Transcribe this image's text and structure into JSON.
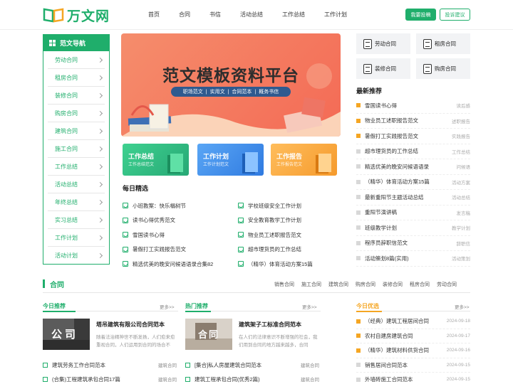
{
  "header": {
    "logo_text": "万文网",
    "nav": [
      "首页",
      "合同",
      "书信",
      "活动总结",
      "工作总结",
      "工作计划"
    ],
    "submit_label": "我要投稿",
    "advice_label": "投诉建议"
  },
  "sidebar": {
    "title": "范文导航",
    "items": [
      "劳动合同",
      "租房合同",
      "装修合同",
      "购房合同",
      "建筑合同",
      "施工合同",
      "工作总结",
      "活动总结",
      "年终总结",
      "实习总结",
      "工作计划",
      "活动计划"
    ]
  },
  "banner": {
    "title": "范文模板资料平台",
    "tags": [
      "职场范文",
      "实用文",
      "合同范本",
      "概务书信"
    ]
  },
  "cards": [
    {
      "title": "工作总结",
      "sub": "工作总结范文",
      "color": "#3cc28a"
    },
    {
      "title": "工作计划",
      "sub": "工作计划范文",
      "color": "#3d8fe6"
    },
    {
      "title": "工作报告",
      "sub": "工作报告范文",
      "color": "#f5a53a"
    }
  ],
  "daily": {
    "title": "每日精选",
    "left": [
      "小班教案：快乐榻树节",
      "读书心得优秀范文",
      "雪国读书心得",
      "暑假打工实践报告范文",
      "精选优美的晚安问候语语录合集82"
    ],
    "right": [
      "学校班级安全工作计划",
      "安全教育教学工作计划",
      "物业员工述职报告范文",
      "超市理货员的工作总结",
      "（精华）体育活动方案15篇"
    ]
  },
  "tiles": [
    "劳动合同",
    "租房合同",
    "装修合同",
    "购房合同"
  ],
  "recommend": {
    "title": "最新推荐",
    "rows": [
      {
        "text": "雪国读书心得",
        "cat": "读后感"
      },
      {
        "text": "物业员工述职报告范文",
        "cat": "述职报告"
      },
      {
        "text": "暑假打工实践报告范文",
        "cat": "实践报告"
      },
      {
        "text": "超市理货员的工作总结",
        "cat": "工作总结"
      },
      {
        "text": "精选优美的晚安问候语语录",
        "cat": "问候语"
      },
      {
        "text": "（精华）体育活动方案15篇",
        "cat": "活动方案"
      },
      {
        "text": "最新重阳节主题活动总结",
        "cat": "活动总结"
      },
      {
        "text": "重阳节演讲稿",
        "cat": "发言稿"
      },
      {
        "text": "班级教学计划",
        "cat": "教学计划"
      },
      {
        "text": "程序员辞职信范文",
        "cat": "辞职信"
      },
      {
        "text": "活动策划8篇(实用)",
        "cat": "活动策划"
      }
    ]
  },
  "contract": {
    "title": "合同",
    "tabs": [
      "销售合同",
      "施工合同",
      "建筑合同",
      "购房合同",
      "装修合同",
      "租房合同",
      "劳动合同"
    ],
    "col1": {
      "title": "今日推荐",
      "more": "更多>>",
      "feature_title": "塔吊建筑有限公司合同范本",
      "feature_img_text": "公司",
      "feature_desc": "随着法治精神世不断发扬，人们愈来愈重视合同，人们运用到合同的场合不",
      "items": [
        {
          "text": "建筑劳务工作合同范本",
          "cat": "建筑合同"
        },
        {
          "text": "(合集)工程建筑承包合同17篇",
          "cat": "建筑合同"
        }
      ]
    },
    "col2": {
      "title": "热门推荐",
      "more": "更多>>",
      "feature_title": "建筑架子工标准合同范本",
      "feature_img_text": "合同",
      "feature_desc": "在人们的法律意识不断增强的社会，我们用到合同的地方越来越多，合同",
      "items": [
        {
          "text": "[集合]私人房屋建筑合同范本",
          "cat": "建筑合同"
        },
        {
          "text": "建筑工程承包合同(优秀2篇)",
          "cat": "建筑合同"
        }
      ]
    },
    "col3": {
      "title": "今日优选",
      "more": "更多>>",
      "items": [
        {
          "text": "（经典）建筑工程居间合同",
          "date": "2024-09-18"
        },
        {
          "text": "农村自建房建筑合同",
          "date": "2024-09-17"
        },
        {
          "text": "（精华）建筑材料供货合同",
          "date": "2024-09-16"
        },
        {
          "text": "销售居间合同范本",
          "date": "2024-09-15"
        },
        {
          "text": "外墙砖施工合同范本",
          "date": "2024-09-15"
        }
      ]
    }
  },
  "colors": {
    "brand": "#1fae6b",
    "accent_orange": "#f5a623"
  }
}
